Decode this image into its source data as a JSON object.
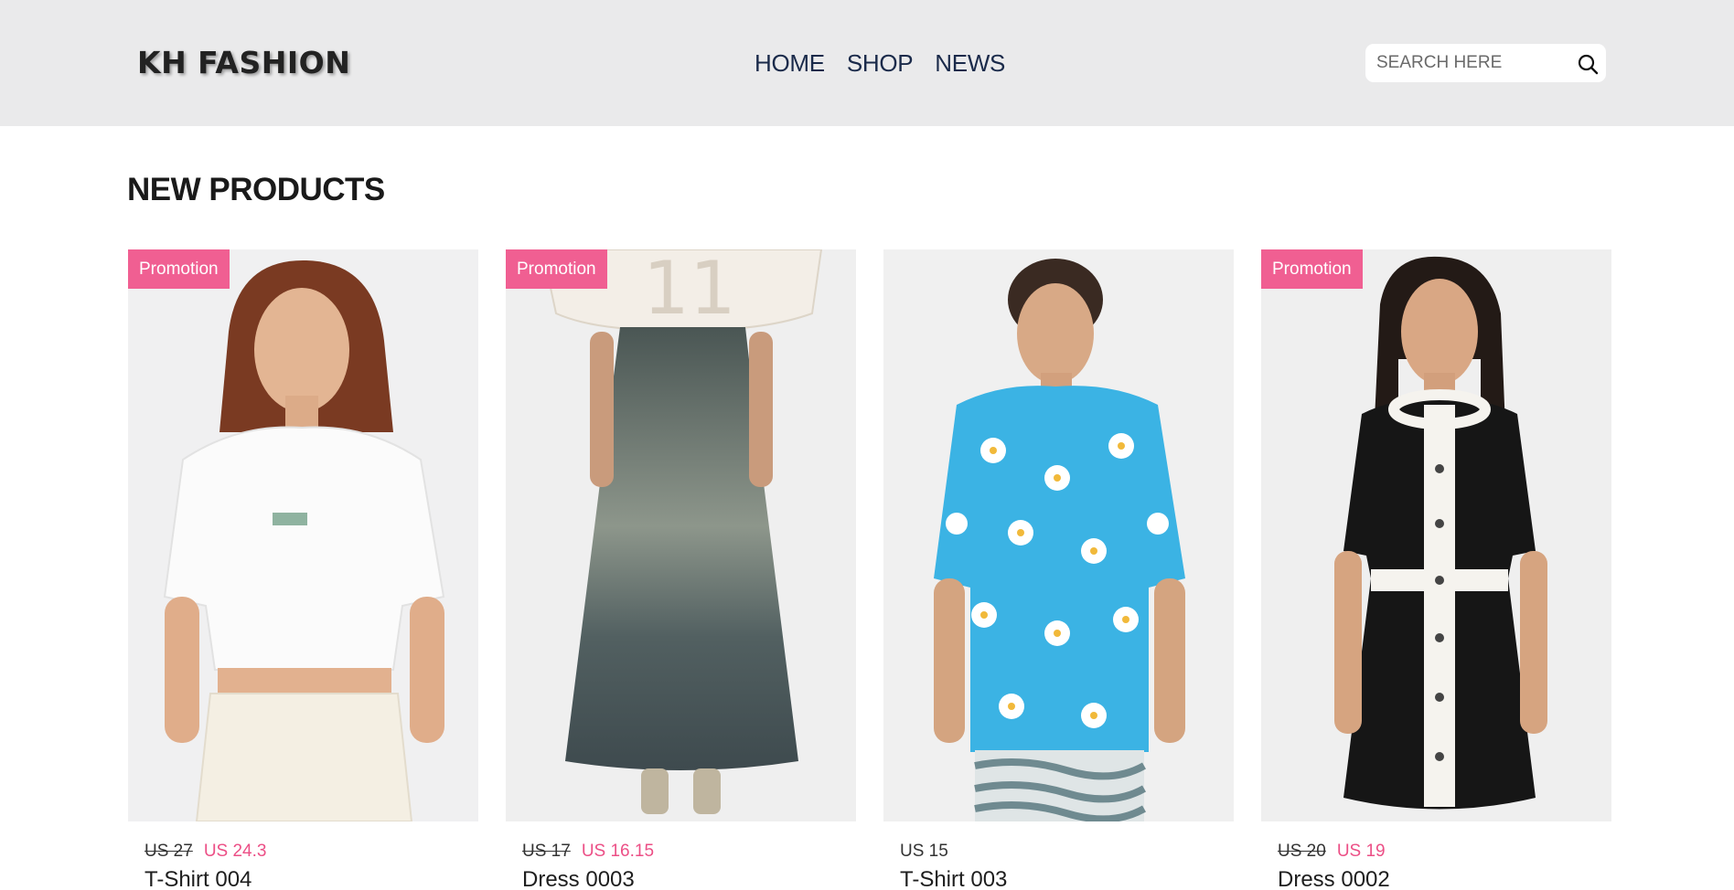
{
  "header": {
    "logo": "KH FASHION",
    "nav": [
      "HOME",
      "SHOP",
      "NEWS"
    ],
    "search_placeholder": "SEARCH HERE"
  },
  "section": {
    "title": "NEW PRODUCTS"
  },
  "products": [
    {
      "badge": "Promotion",
      "old_price": "US 27",
      "price": "US 24.3",
      "name": "T-Shirt 004"
    },
    {
      "badge": "Promotion",
      "old_price": "US 17",
      "price": "US 16.15",
      "name": "Dress 0003"
    },
    {
      "badge": "",
      "old_price": "",
      "price": "US 15",
      "name": "T-Shirt 003"
    },
    {
      "badge": "Promotion",
      "old_price": "US 20",
      "price": "US 19",
      "name": "Dress 0002"
    }
  ],
  "colors": {
    "header_bg": "#eaeaeb",
    "badge_bg": "#f05f92",
    "sale_price": "#ec4f86",
    "nav_text": "#1a2a4a"
  }
}
